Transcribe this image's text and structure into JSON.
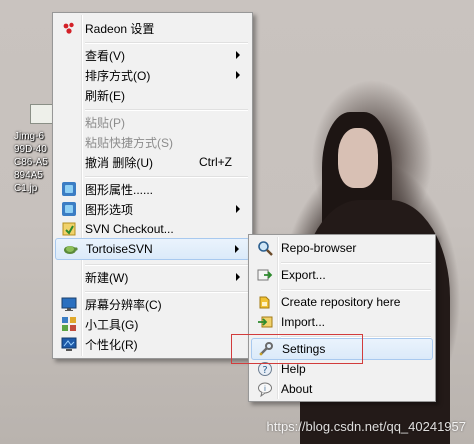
{
  "desktop": {
    "icon_label_lines": [
      "Jimg-6",
      "99D-40",
      "C86-A5",
      "894A5",
      "C1.jp"
    ],
    "watermark": "https://blog.csdn.net/qq_40241957"
  },
  "context_menu": {
    "items": [
      {
        "label": "Radeon 设置",
        "icon": "radeon-icon"
      },
      {
        "label": "查看(V)",
        "submenu": true
      },
      {
        "label": "排序方式(O)",
        "submenu": true
      },
      {
        "label": "刷新(E)"
      },
      {
        "label": "粘贴(P)",
        "disabled": true
      },
      {
        "label": "粘贴快捷方式(S)",
        "disabled": true
      },
      {
        "label": "撤消 删除(U)",
        "shortcut": "Ctrl+Z"
      },
      {
        "label": "图形属性......",
        "icon": "graphics-properties-icon"
      },
      {
        "label": "图形选项",
        "icon": "graphics-options-icon",
        "submenu": true
      },
      {
        "label": "SVN Checkout...",
        "icon": "svn-checkout-icon"
      },
      {
        "label": "TortoiseSVN",
        "icon": "tortoisesvn-icon",
        "submenu": true,
        "active": true
      },
      {
        "label": "新建(W)",
        "submenu": true
      },
      {
        "label": "屏幕分辨率(C)",
        "icon": "screen-resolution-icon"
      },
      {
        "label": "小工具(G)",
        "icon": "gadgets-icon"
      },
      {
        "label": "个性化(R)",
        "icon": "personalize-icon"
      }
    ]
  },
  "svn_submenu": {
    "items": [
      {
        "label": "Repo-browser",
        "icon": "repo-browser-icon"
      },
      {
        "label": "Export...",
        "icon": "export-icon"
      },
      {
        "label": "Create repository here",
        "icon": "create-repository-icon"
      },
      {
        "label": "Import...",
        "icon": "import-icon"
      },
      {
        "label": "Settings",
        "icon": "settings-icon",
        "highlighted": true
      },
      {
        "label": "Help",
        "icon": "help-icon"
      },
      {
        "label": "About",
        "icon": "about-icon"
      }
    ]
  },
  "colors": {
    "highlight_outline": "#d23c3c",
    "menu_background": "#f1f1f1"
  }
}
